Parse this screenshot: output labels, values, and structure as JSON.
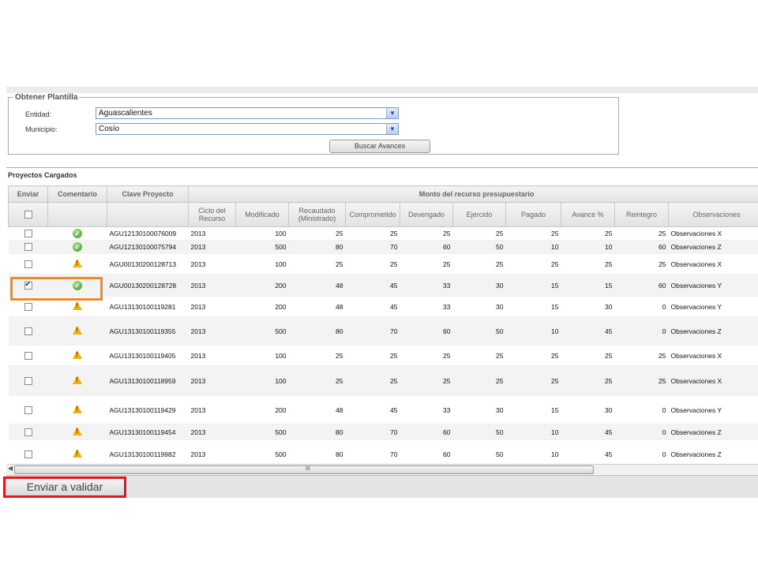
{
  "form": {
    "legend": "Obtener Plantilla",
    "entidad_label": "Entidad:",
    "entidad_value": "Aguascalientes",
    "municipio_label": "Municipio:",
    "municipio_value": "Cosío",
    "search_button": "Buscar Avances"
  },
  "grid": {
    "title": "Proyectos Cargados",
    "headers": {
      "enviar": "Enviar",
      "comentario": "Comentario",
      "clave": "Clave Proyecto",
      "monto": "Monto del recurso presupuestario",
      "ciclo": "Ciclo del Recurso",
      "modificado": "Modificado",
      "recaudado": "Recaudado (Ministrado)",
      "comprometido": "Comprometido",
      "devengado": "Devengado",
      "ejercido": "Ejercido",
      "pagado": "Pagado",
      "avance": "Avance %",
      "reintegro": "Reintegro",
      "observaciones": "Observaciones"
    },
    "rows": [
      {
        "checked": false,
        "status": "ok",
        "clave": "AGU12130100076009",
        "ciclo": "2013",
        "modificado": "100",
        "recaudado": "25",
        "comprometido": "25",
        "devengado": "25",
        "ejercido": "25",
        "pagado": "25",
        "avance": "25",
        "reintegro": "25",
        "obs": "Observaciones X"
      },
      {
        "checked": false,
        "status": "ok",
        "clave": "AGU12130100075794",
        "ciclo": "2013",
        "modificado": "500",
        "recaudado": "80",
        "comprometido": "70",
        "devengado": "60",
        "ejercido": "50",
        "pagado": "10",
        "avance": "10",
        "reintegro": "60",
        "obs": "Observaciones Z"
      },
      {
        "checked": false,
        "status": "warn",
        "clave": "AGU00130200128713",
        "ciclo": "2013",
        "modificado": "100",
        "recaudado": "25",
        "comprometido": "25",
        "devengado": "25",
        "ejercido": "25",
        "pagado": "25",
        "avance": "25",
        "reintegro": "25",
        "obs": "Observaciones X"
      },
      {
        "checked": true,
        "status": "ok",
        "clave": "AGU00130200128728",
        "ciclo": "2013",
        "modificado": "200",
        "recaudado": "48",
        "comprometido": "45",
        "devengado": "33",
        "ejercido": "30",
        "pagado": "15",
        "avance": "15",
        "reintegro": "60",
        "obs": "Observaciones Y"
      },
      {
        "checked": false,
        "status": "warn",
        "clave": "AGU13130100119281",
        "ciclo": "2013",
        "modificado": "200",
        "recaudado": "48",
        "comprometido": "45",
        "devengado": "33",
        "ejercido": "30",
        "pagado": "15",
        "avance": "30",
        "reintegro": "0",
        "obs": "Observaciones Y"
      },
      {
        "checked": false,
        "status": "warn",
        "clave": "AGU13130100119355",
        "ciclo": "2013",
        "modificado": "500",
        "recaudado": "80",
        "comprometido": "70",
        "devengado": "60",
        "ejercido": "50",
        "pagado": "10",
        "avance": "45",
        "reintegro": "0",
        "obs": "Observaciones Z"
      },
      {
        "checked": false,
        "status": "warn",
        "clave": "AGU13130100119405",
        "ciclo": "2013",
        "modificado": "100",
        "recaudado": "25",
        "comprometido": "25",
        "devengado": "25",
        "ejercido": "25",
        "pagado": "25",
        "avance": "25",
        "reintegro": "25",
        "obs": "Observaciones X"
      },
      {
        "checked": false,
        "status": "warn",
        "clave": "AGU13130100118959",
        "ciclo": "2013",
        "modificado": "100",
        "recaudado": "25",
        "comprometido": "25",
        "devengado": "25",
        "ejercido": "25",
        "pagado": "25",
        "avance": "25",
        "reintegro": "25",
        "obs": "Observaciones X"
      },
      {
        "checked": false,
        "status": "warn",
        "clave": "AGU13130100119429",
        "ciclo": "2013",
        "modificado": "200",
        "recaudado": "48",
        "comprometido": "45",
        "devengado": "33",
        "ejercido": "30",
        "pagado": "15",
        "avance": "30",
        "reintegro": "0",
        "obs": "Observaciones Y"
      },
      {
        "checked": false,
        "status": "warn",
        "clave": "AGU13130100119454",
        "ciclo": "2013",
        "modificado": "500",
        "recaudado": "80",
        "comprometido": "70",
        "devengado": "60",
        "ejercido": "50",
        "pagado": "10",
        "avance": "45",
        "reintegro": "0",
        "obs": "Observaciones Z"
      },
      {
        "checked": false,
        "status": "warn",
        "clave": "AGU13130100119982",
        "ciclo": "2013",
        "modificado": "500",
        "recaudado": "80",
        "comprometido": "70",
        "devengado": "60",
        "ejercido": "50",
        "pagado": "10",
        "avance": "45",
        "reintegro": "0",
        "obs": "Observaciones Z"
      }
    ]
  },
  "footer": {
    "send_button": "Enviar a validar",
    "scroll_grip": "III"
  },
  "colors": {
    "highlight_orange": "#f08a24",
    "highlight_red": "#e4161c",
    "ok_green": "#3c9a2a",
    "warn_yellow": "#f2b10c"
  }
}
